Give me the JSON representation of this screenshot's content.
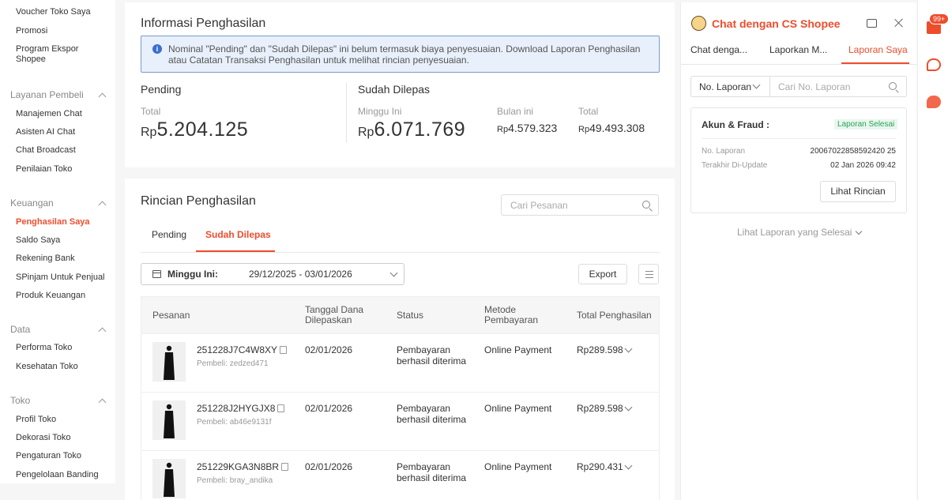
{
  "sidebar": {
    "items_top": [
      "Voucher Toko Saya",
      "Promosi",
      "Program Ekspor Shopee"
    ],
    "groups": [
      {
        "title": "Layanan Pembeli",
        "items": [
          "Manajemen Chat",
          "Asisten AI Chat",
          "Chat Broadcast",
          "Penilaian Toko"
        ]
      },
      {
        "title": "Keuangan",
        "items": [
          "Penghasilan Saya",
          "Saldo Saya",
          "Rekening Bank",
          "SPinjam Untuk Penjual",
          "Produk Keuangan"
        ]
      },
      {
        "title": "Data",
        "items": [
          "Performa Toko",
          "Kesehatan Toko"
        ]
      },
      {
        "title": "Toko",
        "items": [
          "Profil Toko",
          "Dekorasi Toko",
          "Pengaturan Toko",
          "Pengelolaan Banding"
        ]
      }
    ],
    "active_item": "Penghasilan Saya"
  },
  "info": {
    "title": "Informasi Penghasilan",
    "banner_text": "Nominal \"Pending\" dan \"Sudah Dilepas\" ini belum termasuk biaya penyesuaian. Download Laporan Penghasilan atau Catatan Transaksi Penghasilan untuk melihat rincian penyesuaian.",
    "pending": {
      "title": "Pending",
      "label": "Total",
      "currency": "Rp",
      "amount": "5.204.125"
    },
    "released": {
      "title": "Sudah Dilepas",
      "week_label": "Minggu Ini",
      "week_currency": "Rp",
      "week_amount": "6.071.769",
      "month_label": "Bulan ini",
      "month_currency": "Rp",
      "month_amount": "4.579.323",
      "total_label": "Total",
      "total_currency": "Rp",
      "total_amount": "49.493.308"
    }
  },
  "rincian": {
    "title": "Rincian Penghasilan",
    "search_placeholder": "Cari Pesanan",
    "tabs": [
      "Pending",
      "Sudah Dilepas"
    ],
    "active_tab": "Sudah Dilepas",
    "period_label": "Minggu Ini:",
    "period_value": "29/12/2025 - 03/01/2026",
    "export_label": "Export",
    "columns": [
      "Pesanan",
      "Tanggal Dana Dilepaskan",
      "Status",
      "Metode Pembayaran",
      "Total Penghasilan"
    ],
    "rows": [
      {
        "order_id": "251228J7C4W8XY",
        "buyer_label": "Pembeli:",
        "buyer": "zedzed471",
        "date": "02/01/2026",
        "status": "Pembayaran berhasil diterima",
        "method": "Online Payment",
        "total": "Rp289.598"
      },
      {
        "order_id": "251228J2HYGJX8",
        "buyer_label": "Pembeli:",
        "buyer": "ab46e9131f",
        "date": "02/01/2026",
        "status": "Pembayaran berhasil diterima",
        "method": "Online Payment",
        "total": "Rp289.598"
      },
      {
        "order_id": "251229KGA3N8BR",
        "buyer_label": "Pembeli:",
        "buyer": "bray_andika",
        "date": "02/01/2026",
        "status": "Pembayaran berhasil diterima",
        "method": "Online Payment",
        "total": "Rp290.431"
      }
    ]
  },
  "chat": {
    "title": "Chat dengan CS Shopee",
    "tabs": [
      "Chat denga...",
      "Laporkan M...",
      "Laporan Saya"
    ],
    "active_tab": "Laporan Saya",
    "select_label": "No. Laporan",
    "search_placeholder": "Cari No. Laporan",
    "report": {
      "title": "Akun & Fraud :",
      "status": "Laporan Selesai",
      "no_label": "No. Laporan",
      "no_value": "20067022858592420 25",
      "updated_label": "Terakhir Di-Update",
      "updated_value": "02 Jan 2026 09:42",
      "detail_button": "Lihat Rincian"
    },
    "completed_link": "Lihat Laporan yang Selesai"
  },
  "rail": {
    "badge": "99+"
  },
  "colors": {
    "accent": "#ee4d2d",
    "success": "#2aa35b",
    "info": "#3b6fd1"
  }
}
